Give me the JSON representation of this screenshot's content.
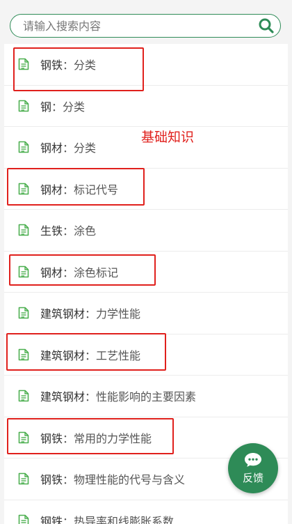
{
  "search": {
    "placeholder": "请输入搜索内容"
  },
  "items": [
    {
      "category": "钢铁",
      "title": "分类"
    },
    {
      "category": "钢",
      "title": "分类"
    },
    {
      "category": "钢材",
      "title": "分类"
    },
    {
      "category": "钢材",
      "title": "标记代号"
    },
    {
      "category": "生铁",
      "title": "涂色"
    },
    {
      "category": "钢材",
      "title": "涂色标记"
    },
    {
      "category": "建筑钢材",
      "title": "力学性能"
    },
    {
      "category": "建筑钢材",
      "title": "工艺性能"
    },
    {
      "category": "建筑钢材",
      "title": "性能影响的主要因素"
    },
    {
      "category": "钢铁",
      "title": "常用的力学性能"
    },
    {
      "category": "钢铁",
      "title": "物理性能的代号与含义"
    },
    {
      "category": "钢铁",
      "title": "热导率和线膨胀系数"
    }
  ],
  "separator": "：",
  "annotation": "基础知识",
  "feedback": {
    "label": "反馈"
  },
  "colors": {
    "accent": "#2e8b57",
    "annotation": "#e0201c"
  }
}
